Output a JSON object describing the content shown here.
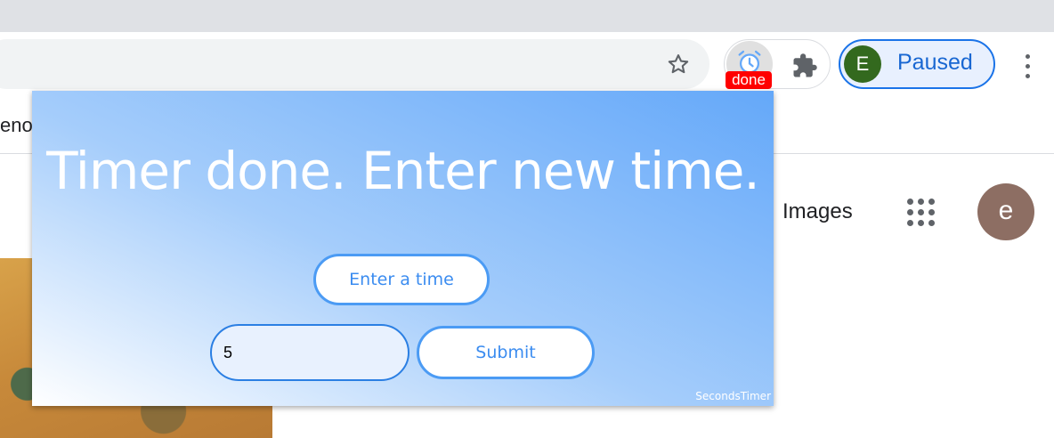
{
  "browser": {
    "extensions": {
      "timer_badge": "done",
      "timer_icon": "alarm-clock-icon",
      "puzzle_icon": "puzzle-icon"
    },
    "profile": {
      "avatar_letter": "E",
      "status_label": "Paused"
    },
    "bookmarks": {
      "partial_label": "eno"
    }
  },
  "page": {
    "images_link": "Images",
    "account_letter": "e"
  },
  "popup": {
    "title": "Timer done. Enter new time.",
    "enter_time_label": "Enter a time",
    "time_input_value": "5",
    "submit_label": "Submit",
    "brand": "SecondsTimer"
  },
  "colors": {
    "badge": "#ff0000",
    "profile_accent": "#1a73e8",
    "popup_gradient_start": "#64a8f9",
    "button_text": "#3b8cf0"
  }
}
